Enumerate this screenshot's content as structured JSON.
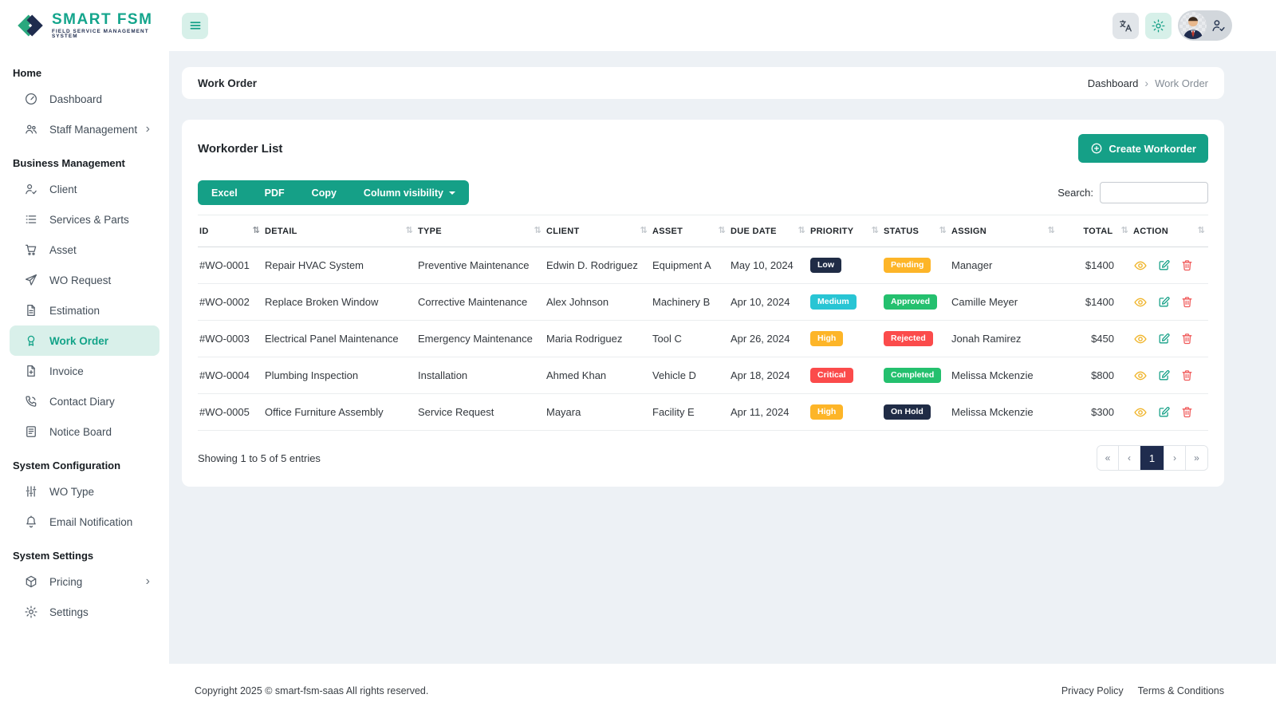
{
  "brand": {
    "name": "SMART FSM",
    "tagline": "FIELD SERVICE MANAGEMENT SYSTEM"
  },
  "sidebar": {
    "sections": [
      {
        "title": "Home",
        "items": [
          {
            "label": "Dashboard",
            "icon": "dashboard-icon"
          },
          {
            "label": "Staff Management",
            "icon": "staff-icon",
            "chevron": true
          }
        ]
      },
      {
        "title": "Business Management",
        "items": [
          {
            "label": "Client",
            "icon": "client-icon"
          },
          {
            "label": "Services & Parts",
            "icon": "services-icon"
          },
          {
            "label": "Asset",
            "icon": "asset-icon"
          },
          {
            "label": "WO Request",
            "icon": "wo-request-icon"
          },
          {
            "label": "Estimation",
            "icon": "estimation-icon"
          },
          {
            "label": "Work Order",
            "icon": "work-order-icon",
            "active": true
          },
          {
            "label": "Invoice",
            "icon": "invoice-icon"
          },
          {
            "label": "Contact Diary",
            "icon": "contact-diary-icon"
          },
          {
            "label": "Notice Board",
            "icon": "notice-board-icon"
          }
        ]
      },
      {
        "title": "System Configuration",
        "items": [
          {
            "label": "WO Type",
            "icon": "wo-type-icon"
          },
          {
            "label": "Email Notification",
            "icon": "bell-icon"
          }
        ]
      },
      {
        "title": "System Settings",
        "items": [
          {
            "label": "Pricing",
            "icon": "pricing-icon",
            "chevron": true
          },
          {
            "label": "Settings",
            "icon": "gear-icon"
          }
        ]
      }
    ]
  },
  "page": {
    "title": "Work Order",
    "breadcrumb": [
      "Dashboard",
      "Work Order"
    ]
  },
  "panel": {
    "title": "Workorder List",
    "create_button": "Create Workorder",
    "export_buttons": [
      "Excel",
      "PDF",
      "Copy"
    ],
    "column_visibility": "Column visibility",
    "search_label": "Search:",
    "search_value": ""
  },
  "table": {
    "columns": [
      {
        "key": "id",
        "label": "ID",
        "sorted": true
      },
      {
        "key": "detail",
        "label": "DETAIL"
      },
      {
        "key": "type",
        "label": "TYPE"
      },
      {
        "key": "client",
        "label": "CLIENT"
      },
      {
        "key": "asset",
        "label": "ASSET"
      },
      {
        "key": "due_date",
        "label": "DUE DATE"
      },
      {
        "key": "priority",
        "label": "PRIORITY"
      },
      {
        "key": "status",
        "label": "STATUS"
      },
      {
        "key": "assign",
        "label": "ASSIGN"
      },
      {
        "key": "total",
        "label": "TOTAL"
      },
      {
        "key": "action",
        "label": "ACTION"
      }
    ],
    "rows": [
      {
        "id": "#WO-0001",
        "detail": "Repair HVAC System",
        "type": "Preventive Maintenance",
        "client": "Edwin D. Rodriguez",
        "asset": "Equipment A",
        "due_date": "May 10, 2024",
        "priority": {
          "label": "Low",
          "color": "navy"
        },
        "status": {
          "label": "Pending",
          "color": "amber"
        },
        "assign": "Manager",
        "total": "$1400"
      },
      {
        "id": "#WO-0002",
        "detail": "Replace Broken Window",
        "type": "Corrective Maintenance",
        "client": "Alex Johnson",
        "asset": "Machinery B",
        "due_date": "Apr 10, 2024",
        "priority": {
          "label": "Medium",
          "color": "cyan"
        },
        "status": {
          "label": "Approved",
          "color": "green"
        },
        "assign": "Camille Meyer",
        "total": "$1400"
      },
      {
        "id": "#WO-0003",
        "detail": "Electrical Panel Maintenance",
        "type": "Emergency Maintenance",
        "client": "Maria Rodriguez",
        "asset": "Tool C",
        "due_date": "Apr 26, 2024",
        "priority": {
          "label": "High",
          "color": "amber"
        },
        "status": {
          "label": "Rejected",
          "color": "red"
        },
        "assign": "Jonah Ramirez",
        "total": "$450"
      },
      {
        "id": "#WO-0004",
        "detail": "Plumbing Inspection",
        "type": "Installation",
        "client": "Ahmed Khan",
        "asset": "Vehicle D",
        "due_date": "Apr 18, 2024",
        "priority": {
          "label": "Critical",
          "color": "red"
        },
        "status": {
          "label": "Completed",
          "color": "green"
        },
        "assign": "Melissa Mckenzie",
        "total": "$800"
      },
      {
        "id": "#WO-0005",
        "detail": "Office Furniture Assembly",
        "type": "Service Request",
        "client": "Mayara",
        "asset": "Facility E",
        "due_date": "Apr 11, 2024",
        "priority": {
          "label": "High",
          "color": "amber"
        },
        "status": {
          "label": "On Hold",
          "color": "navy"
        },
        "assign": "Melissa Mckenzie",
        "total": "$300"
      }
    ],
    "entries_info": "Showing 1 to 5 of 5 entries"
  },
  "pagination": {
    "items": [
      {
        "label": "«"
      },
      {
        "label": "‹"
      },
      {
        "label": "1",
        "active": true
      },
      {
        "label": "›"
      },
      {
        "label": "»"
      }
    ]
  },
  "footer": {
    "copyright": "Copyright 2025 © smart-fsm-saas All rights reserved.",
    "links": [
      "Privacy Policy",
      "Terms & Conditions"
    ]
  },
  "colors": {
    "primary": "#15a087",
    "active_nav_bg": "#d9f0ea",
    "badges": {
      "navy": "#202c46",
      "cyan": "#28c5d4",
      "amber": "#fdb528",
      "red": "#fb4b4b",
      "green": "#24c06e"
    },
    "pagination_active": "#1f2c4e",
    "action_view": "#f0b429",
    "action_edit": "#15a087",
    "action_delete": "#f05a5a"
  }
}
